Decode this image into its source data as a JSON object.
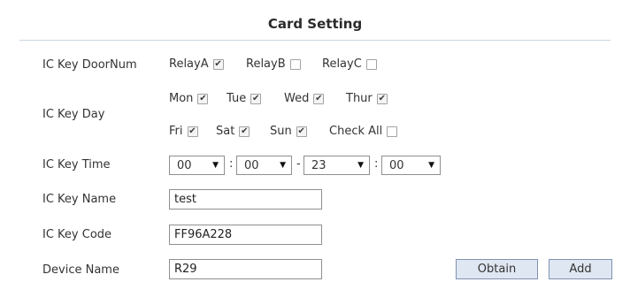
{
  "title": "Card Setting",
  "labels": {
    "door_num": "IC Key DoorNum",
    "day": "IC Key Day",
    "time": "IC Key Time",
    "name": "IC Key Name",
    "code": "IC Key Code",
    "device": "Device Name"
  },
  "relays": [
    {
      "label": "RelayA",
      "checked": true
    },
    {
      "label": "RelayB",
      "checked": false
    },
    {
      "label": "RelayC",
      "checked": false
    }
  ],
  "days": [
    {
      "label": "Mon",
      "checked": true
    },
    {
      "label": "Tue",
      "checked": true
    },
    {
      "label": "Wed",
      "checked": true
    },
    {
      "label": "Thur",
      "checked": true
    },
    {
      "label": "Fri",
      "checked": true
    },
    {
      "label": "Sat",
      "checked": true
    },
    {
      "label": "Sun",
      "checked": true
    },
    {
      "label": "Check All",
      "checked": false
    }
  ],
  "time": {
    "start_hour": "00",
    "start_minute": "00",
    "end_hour": "23",
    "end_minute": "00",
    "colon": ":",
    "dash": "-"
  },
  "fields": {
    "name_value": "test",
    "code_value": "FF96A228",
    "device_value": "R29"
  },
  "buttons": {
    "obtain": "Obtain",
    "add": "Add"
  },
  "icons": {
    "checkbox_checked": "check-mark-icon",
    "dropdown": "triangle-down-icon"
  },
  "colors": {
    "rule": "#c9d4e2",
    "button_bg": "#dfe7f2",
    "button_border": "#7f93b1"
  }
}
